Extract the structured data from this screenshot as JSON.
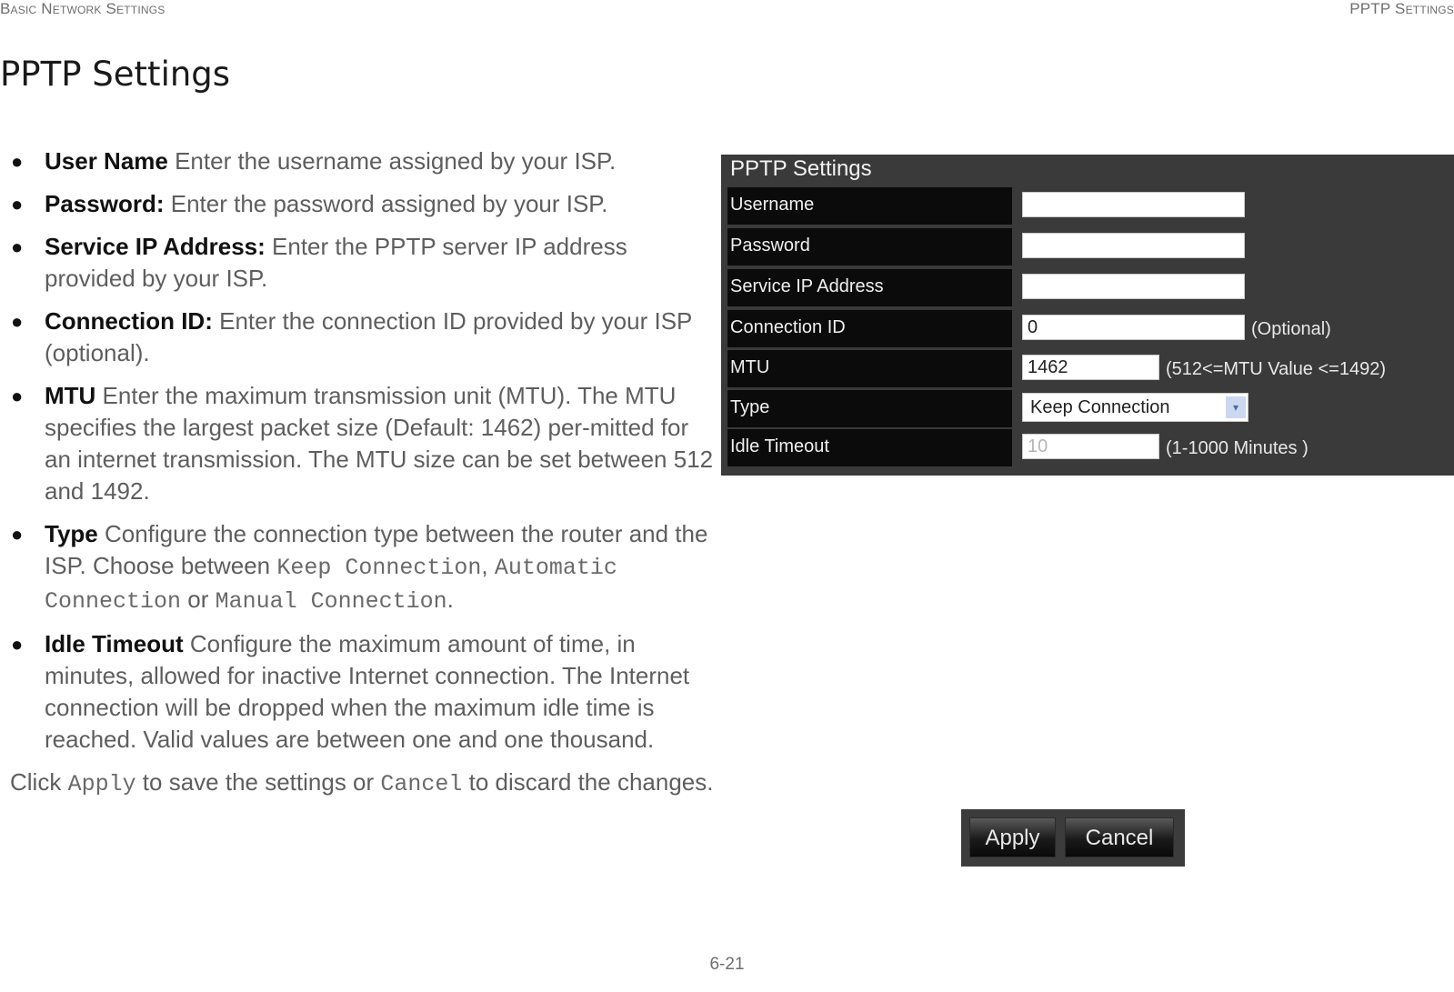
{
  "header": {
    "left": "Basic Network Settings",
    "right": "PPTP Settings"
  },
  "page_title": "PPTP Settings",
  "description": {
    "items": [
      {
        "term": "User Name",
        "text": "  Enter the username assigned by your ISP."
      },
      {
        "term": "Password:",
        "text": " Enter the password assigned by your ISP."
      },
      {
        "term": "Service IP Address:",
        "text": " Enter the PPTP server IP address provided by your ISP."
      },
      {
        "term": "Connection ID:",
        "text": " Enter the connection ID provided by your ISP (optional)."
      },
      {
        "term": "MTU",
        "text": "  Enter the maximum transmission unit (MTU). The MTU specifies the largest packet size (Default: 1462) per-mitted for an internet transmission. The MTU size can be set between 512 and 1492."
      },
      {
        "term": "Type",
        "text_a": "  Configure the connection type between the router and the ISP. Choose between ",
        "opt1": "Keep Connection",
        "sep1": ", ",
        "opt2": "Automatic Connection",
        "sep2": " or ",
        "opt3": "Manual Connection",
        "end": "."
      },
      {
        "term": "Idle Timeout",
        "text": "  Configure the maximum amount of time, in minutes, allowed for inactive Internet connection. The Internet connection will be dropped when the maximum idle time is reached. Valid values are between one and one thousand."
      }
    ],
    "closing": {
      "pre": "Click ",
      "apply": "Apply",
      "mid": " to save the settings or ",
      "cancel": "Cancel",
      "post": " to discard the changes."
    }
  },
  "panel": {
    "title": "PPTP Settings",
    "fields": {
      "username": {
        "label": "Username",
        "value": ""
      },
      "password": {
        "label": "Password",
        "value": ""
      },
      "service_ip": {
        "label": "Service IP Address",
        "value": ""
      },
      "connection_id": {
        "label": "Connection ID",
        "value": "0",
        "hint": "(Optional)"
      },
      "mtu": {
        "label": "MTU",
        "value": "1462",
        "hint": "(512<=MTU Value <=1492)"
      },
      "type": {
        "label": "Type",
        "value": "Keep Connection"
      },
      "idle_timeout": {
        "label": "Idle Timeout",
        "value": "10",
        "hint": "(1-1000 Minutes )"
      }
    },
    "arrow_glyph": "▾"
  },
  "buttons": {
    "apply": "Apply",
    "cancel": "Cancel"
  },
  "footer": {
    "page_number": "6-21"
  }
}
